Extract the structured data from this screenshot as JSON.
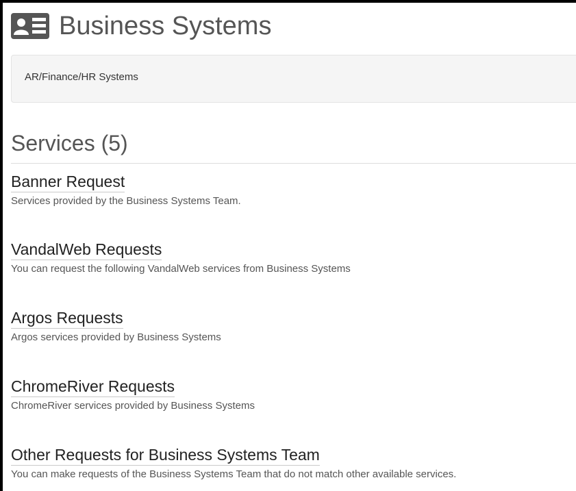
{
  "header": {
    "icon": "id-card-icon",
    "title": "Business Systems"
  },
  "category": {
    "label": "AR/Finance/HR Systems"
  },
  "services_heading": "Services (5)",
  "services": [
    {
      "name": "Banner Request",
      "description": "Services provided by the Business Systems Team."
    },
    {
      "name": "VandalWeb Requests",
      "description": "You can request the following VandalWeb services from Business Systems"
    },
    {
      "name": "Argos Requests",
      "description": "Argos services provided by Business Systems"
    },
    {
      "name": "ChromeRiver Requests",
      "description": "ChromeRiver services provided by Business Systems"
    },
    {
      "name": "Other Requests for Business Systems Team",
      "description": "You can make requests of the Business Systems Team that do not match other available services."
    }
  ],
  "colors": {
    "title": "#555555",
    "link": "#222222",
    "description": "#555555",
    "well_background": "#f5f5f5"
  }
}
